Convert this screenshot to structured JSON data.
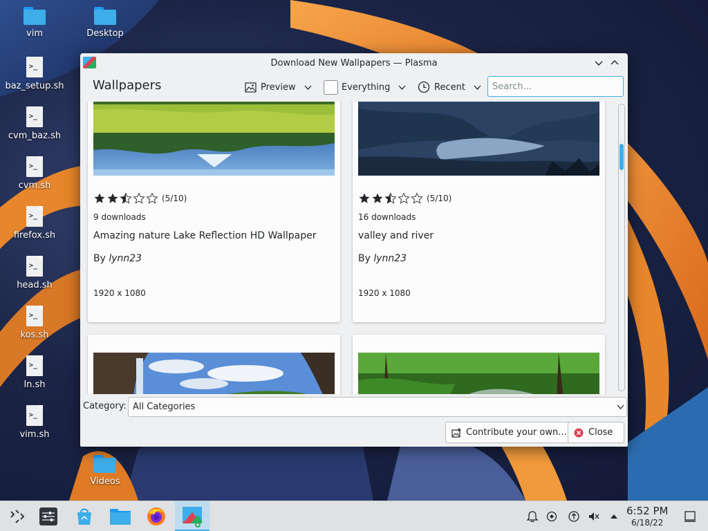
{
  "colors": {
    "accent": "#3daee9",
    "window_bg": "#eff0f1",
    "card_bg": "#fcfcfc",
    "close_red": "#da4453",
    "wallpaper_orange": "#f0902f",
    "wallpaper_navy": "#1c2547"
  },
  "desktop_icons": [
    {
      "label": "vim",
      "icon": "folder-icon"
    },
    {
      "label": "Desktop",
      "icon": "folder-icon"
    },
    {
      "label": "baz_setup.sh",
      "icon": "script-icon"
    },
    {
      "label": "cvm_baz.sh",
      "icon": "script-icon"
    },
    {
      "label": "cvm.sh",
      "icon": "script-icon"
    },
    {
      "label": "firefox.sh",
      "icon": "script-icon"
    },
    {
      "label": "head.sh",
      "icon": "script-icon"
    },
    {
      "label": "kos.sh",
      "icon": "script-icon"
    },
    {
      "label": "ln.sh",
      "icon": "script-icon"
    },
    {
      "label": "vim.sh",
      "icon": "script-icon"
    },
    {
      "label": "Videos",
      "icon": "videos-folder-icon"
    }
  ],
  "window": {
    "title": "Download New Wallpapers — Plasma",
    "heading": "Wallpapers",
    "view_mode": "Preview",
    "filter": "Everything",
    "sort": "Recent",
    "search_placeholder": "Search..."
  },
  "cards": [
    {
      "rating": 0.5,
      "rating_text": "(5/10)",
      "downloads": "9 downloads",
      "title": "Amazing nature Lake Reflection HD Wallpaper",
      "author_prefix": "By",
      "author": "lynn23",
      "resolution": "1920 x 1080"
    },
    {
      "rating": 0.5,
      "rating_text": "(5/10)",
      "downloads": "16 downloads",
      "title": "valley and river",
      "author_prefix": "By",
      "author": "lynn23",
      "resolution": "1920 x 1080"
    }
  ],
  "scroll_position": 0.14,
  "footer": {
    "category_label": "Category:",
    "category_value": "All Categories",
    "contribute_label": "Contribute your own...",
    "close_label": "Close"
  },
  "taskbar": {
    "apps": [
      "application-launcher-icon",
      "system-settings-icon",
      "discover-icon",
      "dolphin-file-manager-icon",
      "firefox-icon",
      "wallpaper-downloader-icon"
    ],
    "tray": [
      "notifications-icon",
      "kde-connect-icon",
      "updates-icon",
      "volume-muted-icon",
      "expand-tray-icon"
    ],
    "time": "6:52 PM",
    "date": "6/18/22"
  }
}
